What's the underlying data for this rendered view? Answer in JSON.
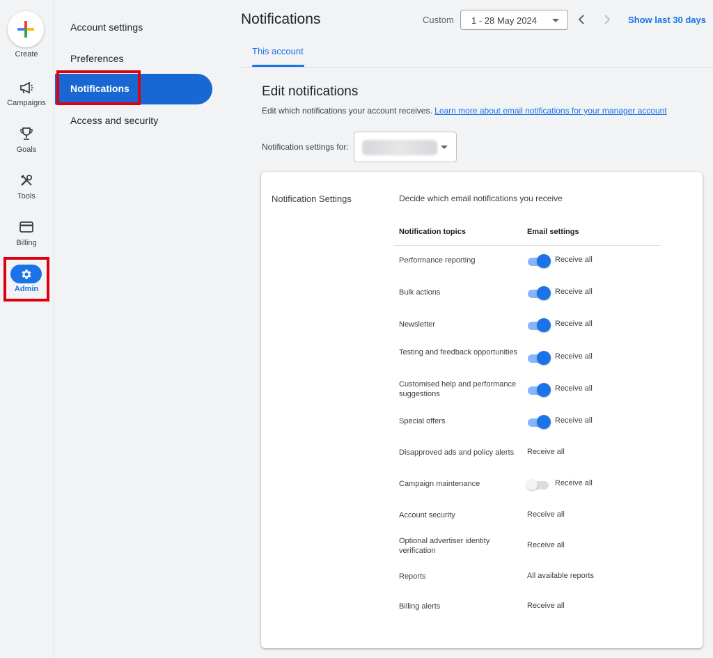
{
  "rail": {
    "create": "Create",
    "items": [
      {
        "label": "Campaigns",
        "icon": "campaigns-megaphone-icon"
      },
      {
        "label": "Goals",
        "icon": "goals-trophy-icon"
      },
      {
        "label": "Tools",
        "icon": "tools-icon"
      },
      {
        "label": "Billing",
        "icon": "billing-card-icon"
      },
      {
        "label": "Admin",
        "icon": "admin-gear-icon"
      }
    ]
  },
  "subnav": {
    "items": [
      "Account settings",
      "Preferences",
      "Notifications",
      "Access and security"
    ]
  },
  "header": {
    "title": "Notifications",
    "custom_label": "Custom",
    "date_range": "1 - 28 May 2024",
    "show_last": "Show last 30 days",
    "tab": "This account"
  },
  "content": {
    "title": "Edit notifications",
    "description": "Edit which notifications your account receives.",
    "learn_more": "Learn more about email notifications for your manager account",
    "settings_for_label": "Notification settings for:"
  },
  "card": {
    "title": "Notification Settings",
    "subtitle": "Decide which email notifications you receive",
    "col_topics": "Notification topics",
    "col_settings": "Email settings",
    "rows": [
      {
        "topic": "Performance reporting",
        "setting": "Receive all",
        "toggle": "on"
      },
      {
        "topic": "Bulk actions",
        "setting": "Receive all",
        "toggle": "on"
      },
      {
        "topic": "Newsletter",
        "setting": "Receive all",
        "toggle": "on"
      },
      {
        "topic": "Testing and feedback opportunities",
        "setting": "Receive all",
        "toggle": "on"
      },
      {
        "topic": "Customised help and performance suggestions",
        "setting": "Receive all",
        "toggle": "on"
      },
      {
        "topic": "Special offers",
        "setting": "Receive all",
        "toggle": "on"
      },
      {
        "topic": "Disapproved ads and policy alerts",
        "setting": "Receive all",
        "toggle": "none"
      },
      {
        "topic": "Campaign maintenance",
        "setting": "Receive all",
        "toggle": "off"
      },
      {
        "topic": "Account security",
        "setting": "Receive all",
        "toggle": "none"
      },
      {
        "topic": "Optional advertiser identity verification",
        "setting": "Receive all",
        "toggle": "none"
      },
      {
        "topic": "Reports",
        "setting": "All available reports",
        "toggle": "none"
      },
      {
        "topic": "Billing alerts",
        "setting": "Receive all",
        "toggle": "none"
      }
    ]
  },
  "colors": {
    "accent": "#1a73e8",
    "active_nav": "#1967d2",
    "highlight_box": "#e0000d"
  }
}
